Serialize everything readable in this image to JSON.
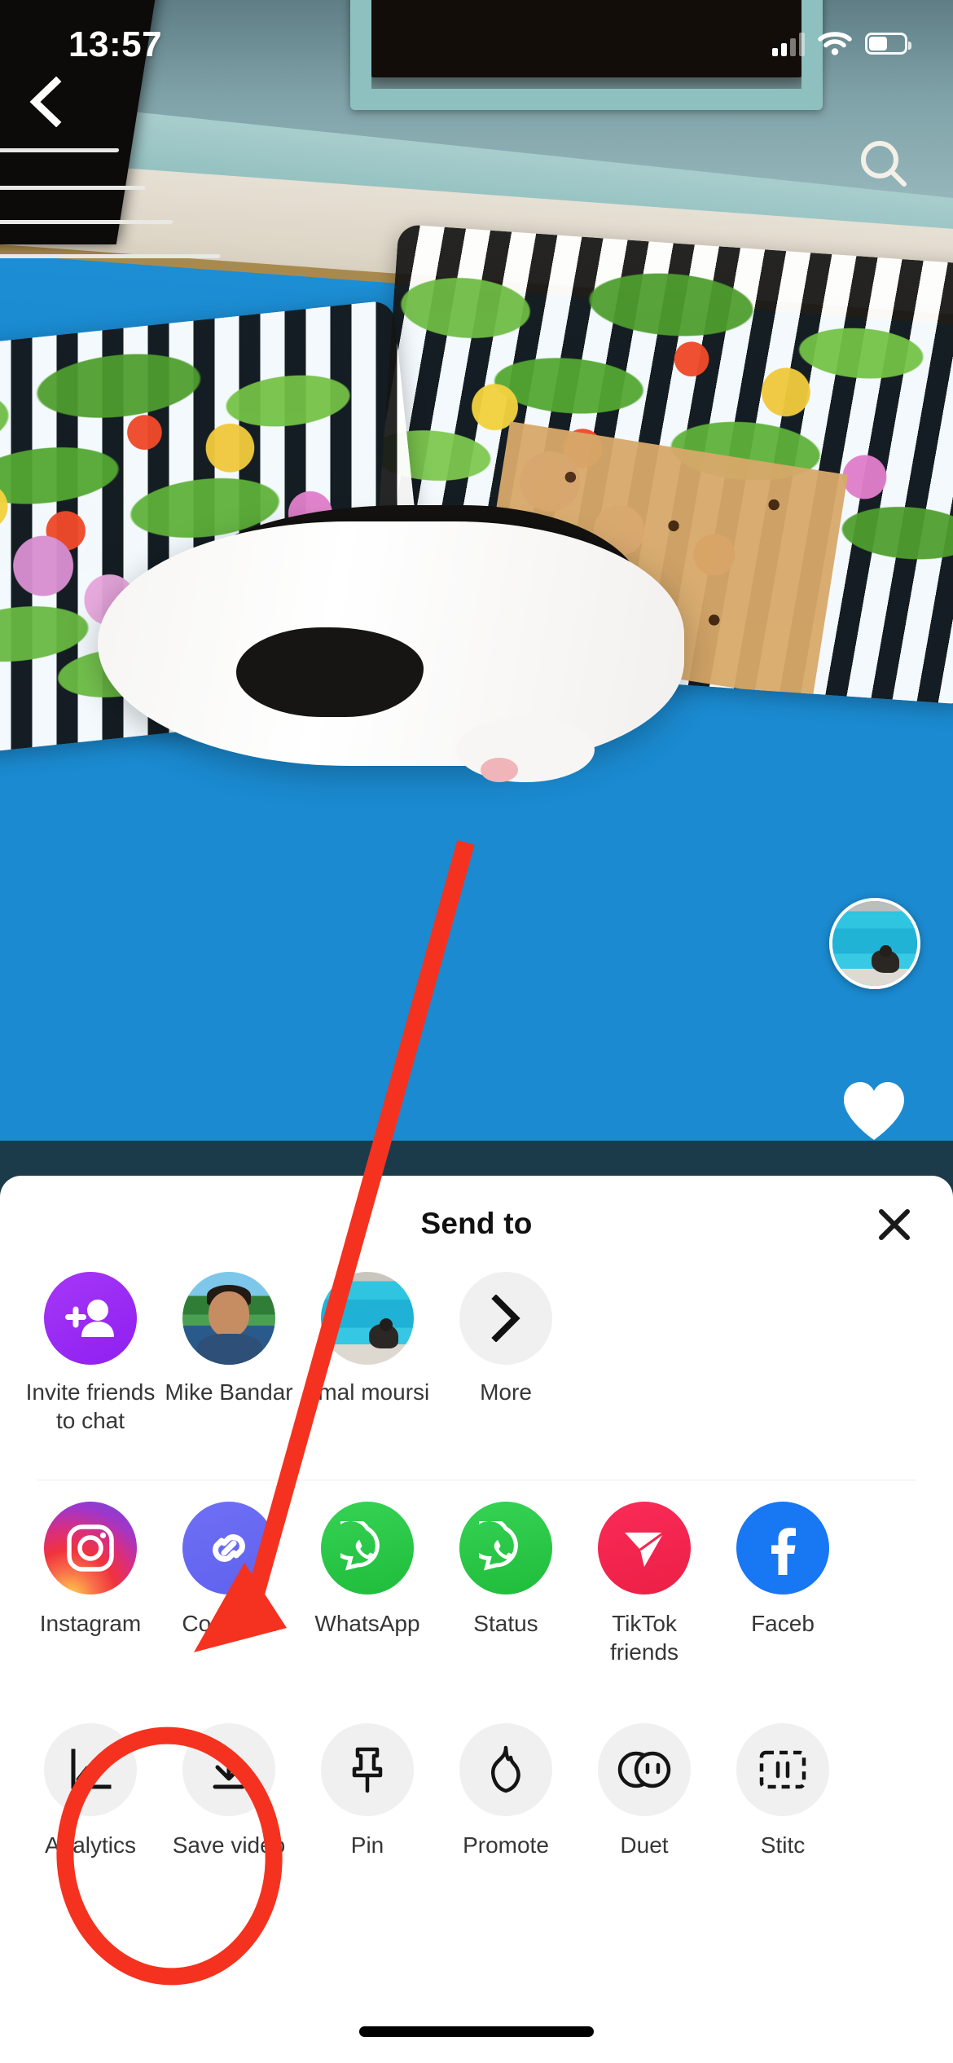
{
  "status_bar": {
    "time": "13:57",
    "cellular_icon": "cellular-signal-icon",
    "wifi_icon": "wifi-icon",
    "battery_icon": "battery-icon"
  },
  "video_screen": {
    "back_icon": "chevron-left-icon",
    "search_icon": "search-icon",
    "avatar_icon": "profile-avatar",
    "like_icon": "heart-icon"
  },
  "share_sheet": {
    "title": "Send to",
    "close_icon": "close-icon",
    "contacts": [
      {
        "label": "Invite friends\nto chat",
        "icon": "add-person-icon",
        "color": "#9b2ff5"
      },
      {
        "label": "Mike Bandar",
        "icon": "contact-avatar"
      },
      {
        "label": "amal moursi",
        "icon": "contact-avatar"
      },
      {
        "label": "More",
        "icon": "chevron-right-icon",
        "color": "#f0f0f1"
      }
    ],
    "apps": [
      {
        "label": "Instagram",
        "icon": "instagram-icon",
        "color": "#d92e7f"
      },
      {
        "label": "Copy link",
        "icon": "link-icon",
        "color": "#6c6ef2"
      },
      {
        "label": "WhatsApp",
        "icon": "whatsapp-icon",
        "color": "#2ec74a"
      },
      {
        "label": "Status",
        "icon": "whatsapp-status-icon",
        "color": "#2ec74a"
      },
      {
        "label": "TikTok\nfriends",
        "icon": "send-plane-icon",
        "color": "#f5254f"
      },
      {
        "label": "Faceb",
        "icon": "facebook-icon",
        "color": "#1877f2"
      }
    ],
    "actions": [
      {
        "label": "Analytics",
        "icon": "line-chart-icon"
      },
      {
        "label": "Save video",
        "icon": "download-icon"
      },
      {
        "label": "Pin",
        "icon": "pushpin-icon"
      },
      {
        "label": "Promote",
        "icon": "flame-icon"
      },
      {
        "label": "Duet",
        "icon": "duet-circles-icon"
      },
      {
        "label": "Stitc",
        "icon": "stitch-icon"
      }
    ]
  },
  "annotation": {
    "arrow_icon": "red-arrow-annotation",
    "circle_icon": "red-circle-annotation",
    "color": "#f5321f",
    "target_label": "Save video"
  },
  "home_indicator": "home-indicator"
}
